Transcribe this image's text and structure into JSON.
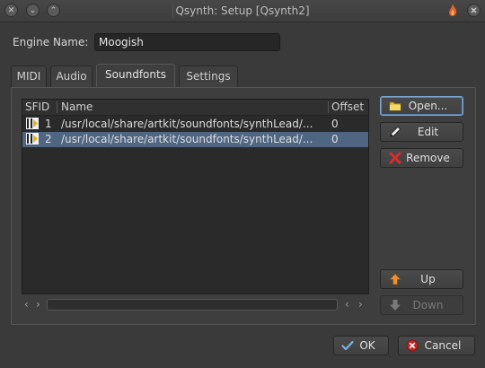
{
  "window": {
    "title": "Qsynth: Setup [Qsynth2]",
    "close_glyph": "✕",
    "minimize_glyph": "⌄",
    "maximize_glyph": "⌃"
  },
  "engine": {
    "label": "Engine Name:",
    "value": "Moogish"
  },
  "tabs": [
    {
      "label": "MIDI",
      "active": false
    },
    {
      "label": "Audio",
      "active": false
    },
    {
      "label": "Soundfonts",
      "active": true
    },
    {
      "label": "Settings",
      "active": false
    }
  ],
  "soundfonts": {
    "columns": [
      "SFID",
      "Name",
      "Offset"
    ],
    "rows": [
      {
        "sfid": "1",
        "name": "/usr/local/share/artkit/soundfonts/synthLead/...",
        "offset": "0",
        "selected": false
      },
      {
        "sfid": "2",
        "name": "/usr/local/share/artkit/soundfonts/synthLead/...",
        "offset": "0",
        "selected": true
      }
    ]
  },
  "scroll_arrows": {
    "left": "‹",
    "right": "›"
  },
  "side_buttons": {
    "open": "Open...",
    "edit": "Edit",
    "remove": "Remove",
    "up": "Up",
    "down": "Down"
  },
  "footer": {
    "ok": "OK",
    "cancel": "Cancel"
  },
  "colors": {
    "selection": "#4f6683",
    "background": "#3a3a3a"
  }
}
